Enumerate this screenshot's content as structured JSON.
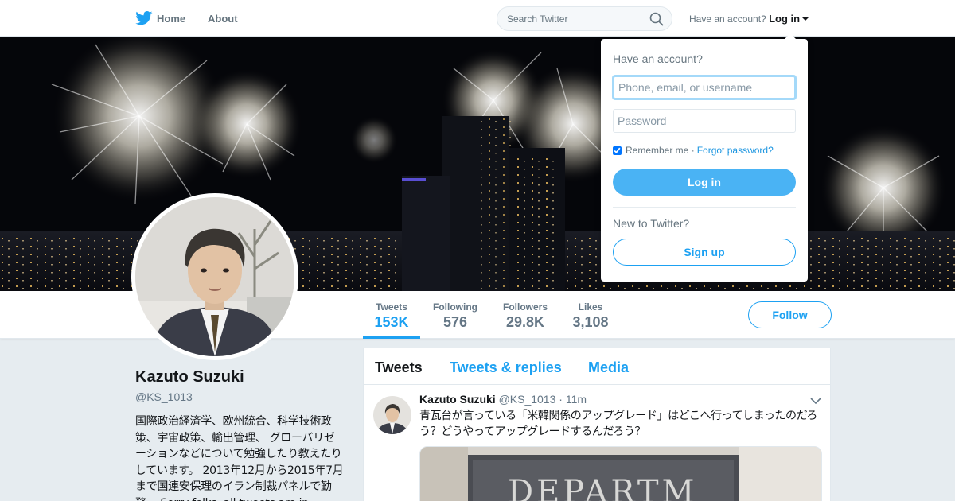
{
  "nav": {
    "home_label": "Home",
    "about_label": "About",
    "search_placeholder": "Search Twitter",
    "account_prompt": "Have an account?",
    "login_label": "Log in"
  },
  "profile": {
    "name": "Kazuto Suzuki",
    "handle": "@KS_1013",
    "bio": "国際政治経済学、欧州統合、科学技術政策、宇宙政策、輸出管理、 グローバリゼーションなどについて勉強したり教えたりしています。 2013年12月から2015年7月まで国連安保理のイラン制裁パネルで勤務。 Sorry folks, all tweets are in"
  },
  "stats": [
    {
      "label": "Tweets",
      "value": "153K"
    },
    {
      "label": "Following",
      "value": "576"
    },
    {
      "label": "Followers",
      "value": "29.8K"
    },
    {
      "label": "Likes",
      "value": "3,108"
    }
  ],
  "follow_label": "Follow",
  "timeline": {
    "tabs": [
      "Tweets",
      "Tweets & replies",
      "Media"
    ],
    "tweet": {
      "name": "Kazuto Suzuki",
      "handle": "@KS_1013",
      "time": "· 11m",
      "text": "青瓦台が言っている「米韓関係のアップグレード」はどこへ行ってしまったのだろう？どうやってアップグレードするんだろう？"
    }
  },
  "login_dropdown": {
    "title": "Have an account?",
    "username_placeholder": "Phone, email, or username",
    "password_placeholder": "Password",
    "remember_label": "Remember me",
    "forgot_label": "Forgot password?",
    "login_button": "Log in",
    "new_prompt": "New to Twitter?",
    "signup_button": "Sign up"
  },
  "colors": {
    "brand_blue": "#1da1f2",
    "login_button_blue": "#4ab3f4",
    "page_background": "#e6ecf0"
  }
}
